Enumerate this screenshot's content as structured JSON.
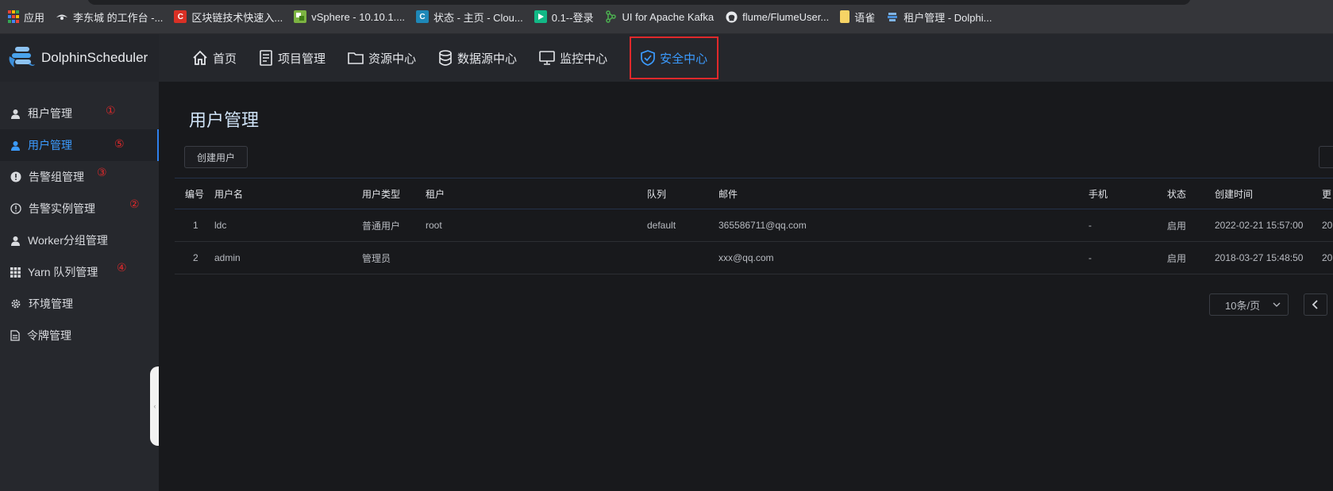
{
  "bookmarks": [
    {
      "label": "应用",
      "icon": "apps-grid-icon"
    },
    {
      "label": "李东城 的工作台 -...",
      "icon": "bird-icon"
    },
    {
      "label": "区块链技术快速入...",
      "icon": "c-red-icon"
    },
    {
      "label": "vSphere - 10.10.1....",
      "icon": "vsphere-icon"
    },
    {
      "label": "状态 - 主页 - Clou...",
      "icon": "c-blue-icon"
    },
    {
      "label": "0.1--登录",
      "icon": "play-green-icon"
    },
    {
      "label": "UI for Apache Kafka",
      "icon": "kafka-icon"
    },
    {
      "label": "flume/FlumeUser...",
      "icon": "github-icon"
    },
    {
      "label": "语雀",
      "icon": "yuque-icon"
    },
    {
      "label": "租户管理 - Dolphi...",
      "icon": "dolphin-icon"
    }
  ],
  "app": {
    "name": "DolphinScheduler"
  },
  "nav": [
    {
      "label": "首页",
      "icon": "home-icon"
    },
    {
      "label": "项目管理",
      "icon": "document-icon"
    },
    {
      "label": "资源中心",
      "icon": "folder-icon"
    },
    {
      "label": "数据源中心",
      "icon": "database-icon"
    },
    {
      "label": "监控中心",
      "icon": "monitor-icon"
    },
    {
      "label": "安全中心",
      "icon": "shield-icon",
      "active": true
    }
  ],
  "sidebar": [
    {
      "label": "租户管理",
      "icon": "user-icon",
      "annotation": "①"
    },
    {
      "label": "用户管理",
      "icon": "user-icon",
      "annotation": "⑤",
      "active": true
    },
    {
      "label": "告警组管理",
      "icon": "alert-filled-icon",
      "annotation": "③"
    },
    {
      "label": "告警实例管理",
      "icon": "alert-outline-icon",
      "annotation": "②"
    },
    {
      "label": "Worker分组管理",
      "icon": "user-icon",
      "annotation": ""
    },
    {
      "label": "Yarn 队列管理",
      "icon": "grid-icon",
      "annotation": "④"
    },
    {
      "label": "环境管理",
      "icon": "gear-icon",
      "annotation": ""
    },
    {
      "label": "令牌管理",
      "icon": "token-icon",
      "annotation": ""
    }
  ],
  "main": {
    "title": "用户管理",
    "create_button": "创建用户",
    "columns": [
      "编号",
      "用户名",
      "用户类型",
      "租户",
      "队列",
      "邮件",
      "手机",
      "状态",
      "创建时间",
      "更"
    ],
    "rows": [
      [
        "1",
        "ldc",
        "普通用户",
        "root",
        "default",
        "365586711@qq.com",
        "-",
        "启用",
        "2022-02-21 15:57:00",
        "20"
      ],
      [
        "2",
        "admin",
        "管理员",
        "",
        "",
        "xxx@qq.com",
        "-",
        "启用",
        "2018-03-27 15:48:50",
        "20"
      ]
    ],
    "page_size": "10条/页"
  },
  "colors": {
    "accent": "#3b9bff",
    "annotation": "#e0292b"
  }
}
